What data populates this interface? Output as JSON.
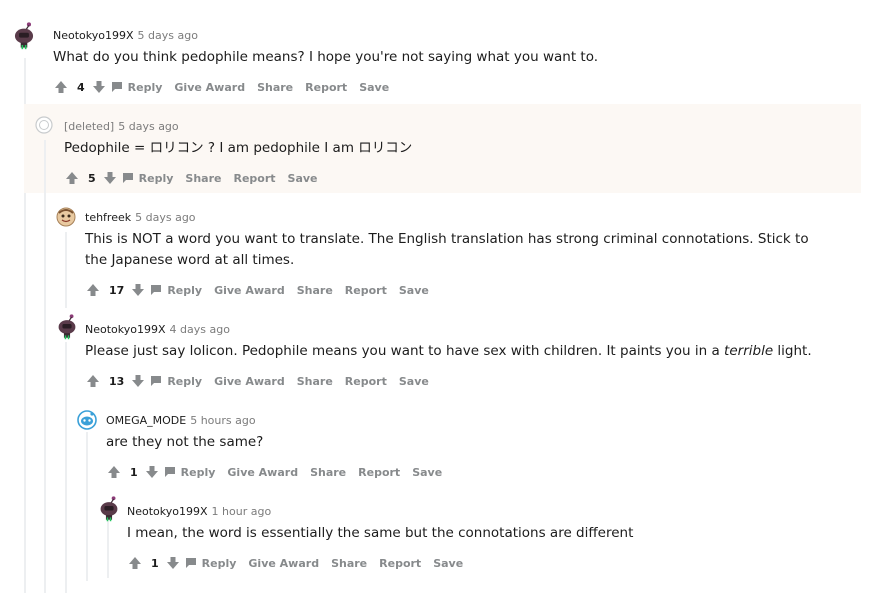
{
  "comments": [
    {
      "author": "Neotokyo199X",
      "age": "5 days ago",
      "text": "What do you think pedophile means? I hope you're not saying what you want to.",
      "score": "4",
      "actions": [
        "Reply",
        "Give Award",
        "Share",
        "Report",
        "Save"
      ]
    },
    {
      "author": "[deleted]",
      "age": "5 days ago",
      "text": "Pedophile = ロリコン ? I am pedophile I am ロリコン",
      "score": "5",
      "actions": [
        "Reply",
        "Share",
        "Report",
        "Save"
      ]
    },
    {
      "author": "tehfreek",
      "age": "5 days ago",
      "text": "This is NOT a word you want to translate. The English translation has strong criminal connotations. Stick to the Japanese word at all times.",
      "score": "17",
      "actions": [
        "Reply",
        "Give Award",
        "Share",
        "Report",
        "Save"
      ]
    },
    {
      "author": "Neotokyo199X",
      "age": "4 days ago",
      "text_before": "Please just say lolicon. Pedophile means you want to have sex with children. It paints you in a ",
      "text_italic": "terrible",
      "text_after": " light.",
      "score": "13",
      "actions": [
        "Reply",
        "Give Award",
        "Share",
        "Report",
        "Save"
      ]
    },
    {
      "author": "OMEGA_MODE",
      "age": "5 hours ago",
      "text": "are they not the same?",
      "score": "1",
      "actions": [
        "Reply",
        "Give Award",
        "Share",
        "Report",
        "Save"
      ]
    },
    {
      "author": "Neotokyo199X",
      "age": "1 hour ago",
      "text": "I mean, the word is essentially the same but the connotations are different",
      "score": "1",
      "actions": [
        "Reply",
        "Give Award",
        "Share",
        "Report",
        "Save"
      ]
    }
  ],
  "icons": {
    "upvote": "upvote-arrow-icon",
    "downvote": "downvote-arrow-icon",
    "reply": "chat-bubble-icon"
  },
  "colors": {
    "highlight": "#fcf8f4",
    "thread_line": "#edeff1",
    "action_text": "#878a8c",
    "meta_text": "#7c7c7c"
  }
}
